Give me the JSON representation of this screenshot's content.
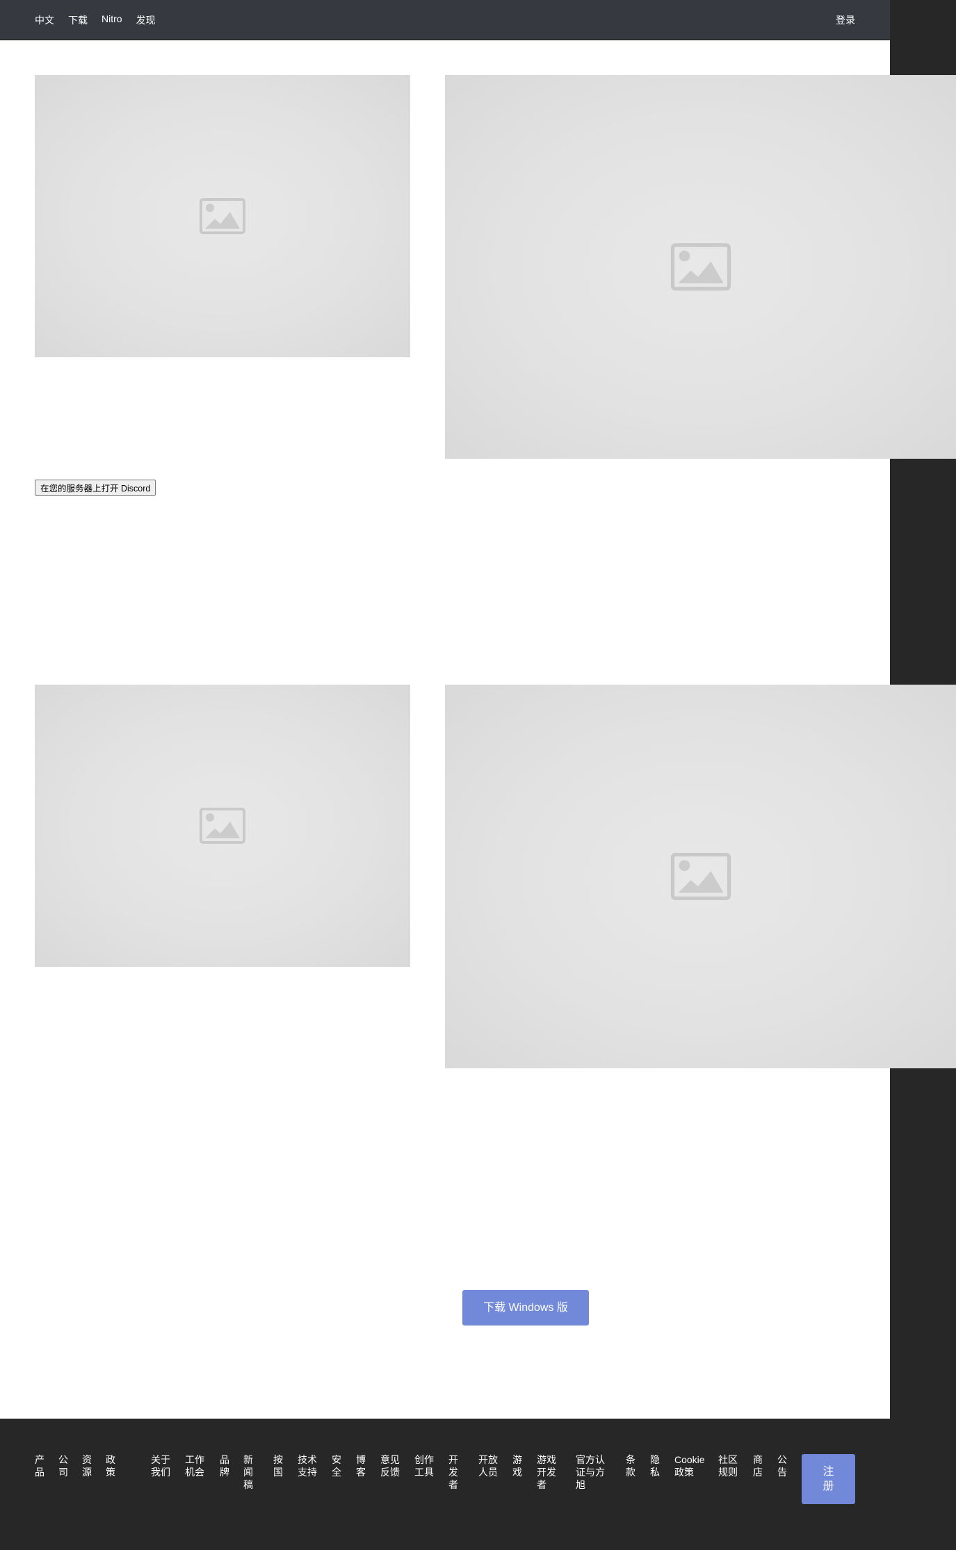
{
  "header": {
    "nav": [
      "中文",
      "下载",
      "Nitro",
      "发现"
    ],
    "login": "登录"
  },
  "main": {
    "open_button": "在您的服务器上打开 Discord",
    "download_button": "下载 Windows 版"
  },
  "footer": {
    "headings": [
      "产品",
      "公司",
      "资源",
      "政策"
    ],
    "links": [
      "关于我们",
      "工作机会",
      "品牌",
      "新闻稿",
      "按国",
      "技术支持",
      "安全",
      "博客",
      "意见反馈",
      "创作工具",
      "开发者",
      "开放人员",
      "游戏",
      "游戏开发者",
      "官方认证与方旭",
      "条款",
      "隐私",
      "Cookie 政策",
      "社区规则",
      "商店",
      "公告"
    ],
    "signup": "注册"
  },
  "colors": {
    "header_bg": "#363940",
    "page_bg": "#272727",
    "accent": "#7289da"
  },
  "icons": [
    "image-placeholder-icon"
  ]
}
